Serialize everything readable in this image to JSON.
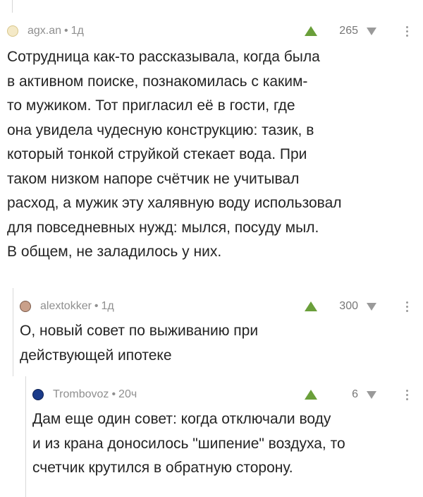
{
  "comments": [
    {
      "author": "agx.an",
      "age": "1д",
      "rating": "265",
      "lines": [
        "Сотрудница как-то рассказывала, когда была",
        "в активном поиске, познакомилась с каким-",
        "то мужиком. Тот пригласил её в гости, где",
        "она увидела чудесную конструкцию: тазик, в",
        "который тонкой струйкой стекает вода. При",
        "таком низком напоре счётчик не учитывал",
        "расход, а мужик эту халявную воду использовал",
        "для повседневных нужд: мылся, посуду мыл.",
        "В общем, не заладилось у них."
      ]
    },
    {
      "author": "alextokker",
      "age": "1д",
      "rating": "300",
      "lines": [
        "О, новый совет по выживанию при",
        "действующей ипотеке"
      ]
    },
    {
      "author": "Trombovoz",
      "age": "20ч",
      "rating": "6",
      "lines": [
        "Дам еще один совет: когда отключали воду",
        "и из крана доносилось \"шипение\" воздуха, то",
        "счетчик крутился в обратную сторону."
      ]
    }
  ],
  "separator": "•",
  "icons": {
    "upvote": "upvote-arrow-icon",
    "downvote": "downvote-arrow-icon",
    "more": "more-vertical-icon"
  },
  "colors": {
    "upvote": "#6a9f3a",
    "meta": "#8f8f8f",
    "thread_line": "#d9d9d9"
  }
}
